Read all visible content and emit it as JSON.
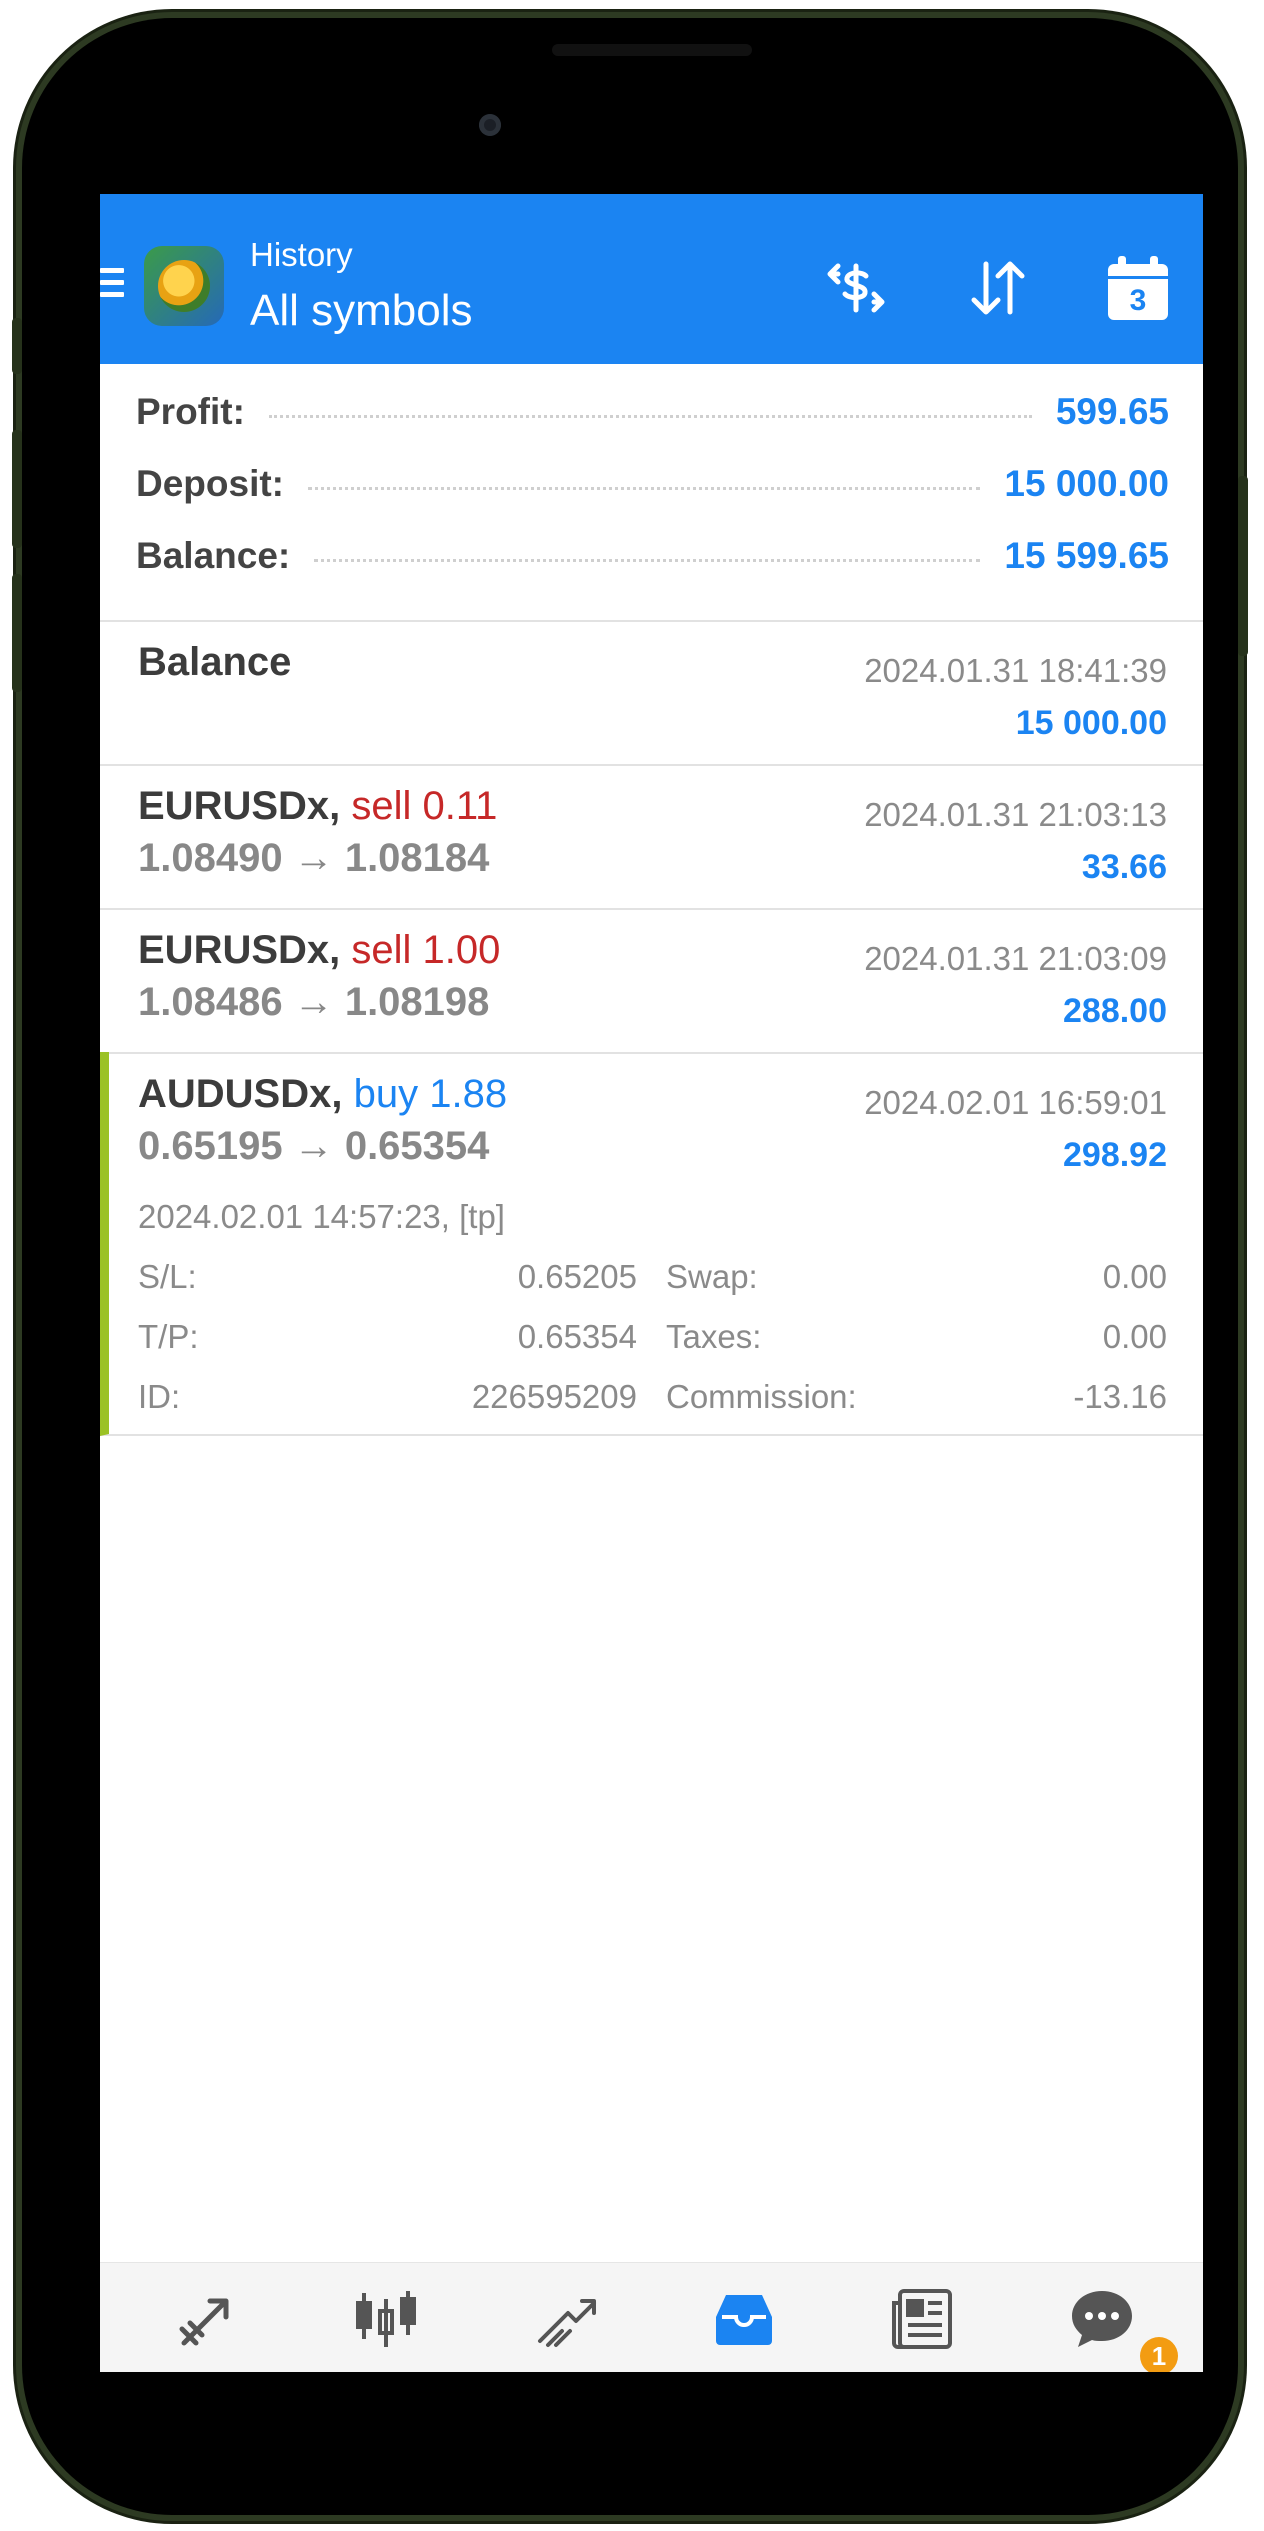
{
  "header": {
    "subtitle": "History",
    "title": "All symbols",
    "calendar_day": "3"
  },
  "summary": {
    "profit_label": "Profit:",
    "profit_value": "599.65",
    "deposit_label": "Deposit:",
    "deposit_value": "15 000.00",
    "balance_label": "Balance:",
    "balance_value": "15 599.65"
  },
  "balance_row": {
    "label": "Balance",
    "time": "2024.01.31 18:41:39",
    "amount": "15 000.00"
  },
  "deals": [
    {
      "symbol": "EURUSDx,",
      "action": "sell 0.11",
      "prices": "1.08490 → 1.08184",
      "time": "2024.01.31 21:03:13",
      "amount": "33.66"
    },
    {
      "symbol": "EURUSDx,",
      "action": "sell 1.00",
      "prices": "1.08486 → 1.08198",
      "time": "2024.01.31 21:03:09",
      "amount": "288.00"
    },
    {
      "symbol": "AUDUSDx,",
      "action": "buy 1.88",
      "prices": "0.65195 → 0.65354",
      "time": "2024.02.01 16:59:01",
      "amount": "298.92",
      "open_info": "2024.02.01 14:57:23, [tp]",
      "sl_label": "S/L:",
      "sl_value": "0.65205",
      "tp_label": "T/P:",
      "tp_value": "0.65354",
      "id_label": "ID:",
      "id_value": "226595209",
      "swap_label": "Swap:",
      "swap_value": "0.00",
      "taxes_label": "Taxes:",
      "taxes_value": "0.00",
      "commission_label": "Commission:",
      "commission_value": "-13.16"
    }
  ],
  "bottom_nav": {
    "active": "history",
    "items": [
      "quotes",
      "chart",
      "trade",
      "history",
      "news",
      "messages"
    ],
    "messages_badge": "1"
  },
  "colors": {
    "accent": "#1b84f2",
    "sell": "#c62828",
    "expanded_marker": "#9bc225",
    "badge": "#f39c12"
  }
}
